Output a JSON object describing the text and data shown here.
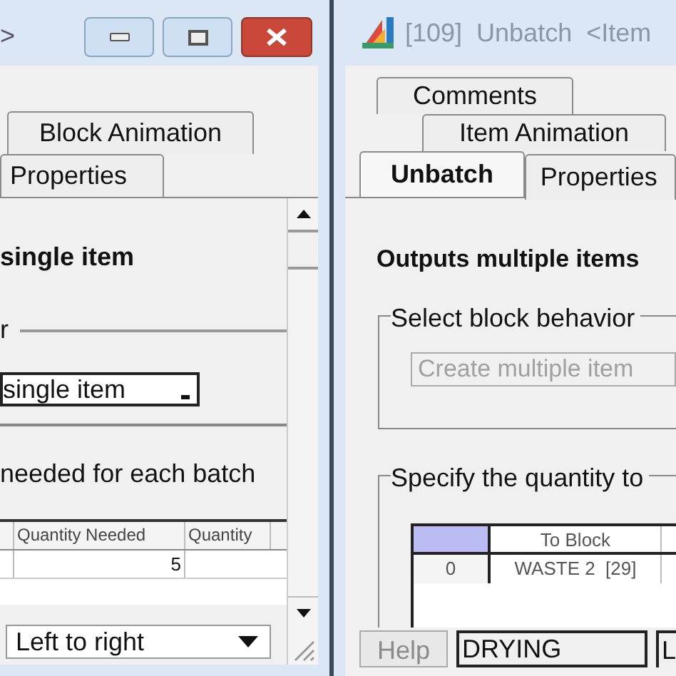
{
  "left_window": {
    "title": ">",
    "tabs": [
      {
        "label": "Block Animation",
        "selected": false
      },
      {
        "label": "Properties",
        "selected": false
      }
    ],
    "heading": "single item",
    "group_label": "r",
    "behavior_dropdown": {
      "value": "single item"
    },
    "quantity_label": "needed for each batch",
    "table": {
      "columns": [
        "Quantity Needed",
        "Quantity"
      ],
      "rows": [
        [
          "5"
        ]
      ]
    },
    "order_dropdown": {
      "value": "Left to right"
    }
  },
  "right_window": {
    "title": "[109]  Unbatch  <Item",
    "tab_rows": [
      [
        {
          "label": "Comments",
          "selected": false
        }
      ],
      [
        {
          "label": "Item Animation",
          "selected": false
        }
      ],
      [
        {
          "label": "Unbatch",
          "selected": true
        },
        {
          "label": "Properties",
          "selected": false
        }
      ]
    ],
    "heading": "Outputs multiple items",
    "behavior_group": "Select block behavior",
    "behavior_dropdown": {
      "value": "Create multiple item",
      "disabled": true
    },
    "quantity_group": "Specify the quantity to",
    "table": {
      "columns": [
        "To Block"
      ],
      "rows": [
        {
          "index": "0",
          "cells": [
            "WASTE 2  [29]"
          ]
        }
      ]
    },
    "help_button": {
      "label": "Help",
      "disabled": true
    },
    "name_field": {
      "value": "DRYING"
    },
    "cut_label": "L"
  }
}
